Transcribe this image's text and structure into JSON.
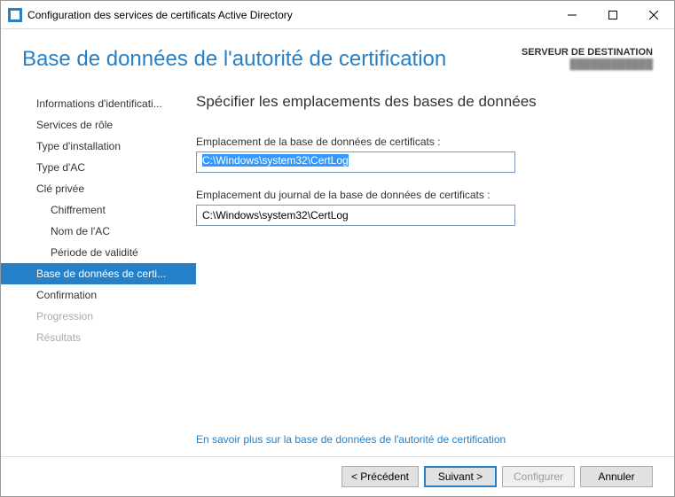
{
  "window": {
    "title": "Configuration des services de certificats Active Directory"
  },
  "header": {
    "title": "Base de données de l'autorité de certification",
    "destination_label": "SERVEUR DE DESTINATION",
    "destination_server": "████████████"
  },
  "sidebar": {
    "items": [
      {
        "label": "Informations d'identificati...",
        "level": "top"
      },
      {
        "label": "Services de rôle",
        "level": "top"
      },
      {
        "label": "Type d'installation",
        "level": "top"
      },
      {
        "label": "Type d'AC",
        "level": "top"
      },
      {
        "label": "Clé privée",
        "level": "top"
      },
      {
        "label": "Chiffrement",
        "level": "sub"
      },
      {
        "label": "Nom de l'AC",
        "level": "sub"
      },
      {
        "label": "Période de validité",
        "level": "sub"
      },
      {
        "label": "Base de données de certi...",
        "level": "top",
        "selected": true
      },
      {
        "label": "Confirmation",
        "level": "top"
      },
      {
        "label": "Progression",
        "level": "top",
        "disabled": true
      },
      {
        "label": "Résultats",
        "level": "top",
        "disabled": true
      }
    ]
  },
  "main": {
    "heading": "Spécifier les emplacements des bases de données",
    "db_location_label": "Emplacement de la base de données de certificats :",
    "db_location_value": "C:\\Windows\\system32\\CertLog",
    "log_location_label": "Emplacement du journal de la base de données de certificats :",
    "log_location_value": "C:\\Windows\\system32\\CertLog",
    "learn_more": "En savoir plus sur la base de données de l'autorité de certification"
  },
  "footer": {
    "previous": "< Précédent",
    "next": "Suivant >",
    "configure": "Configurer",
    "cancel": "Annuler"
  }
}
